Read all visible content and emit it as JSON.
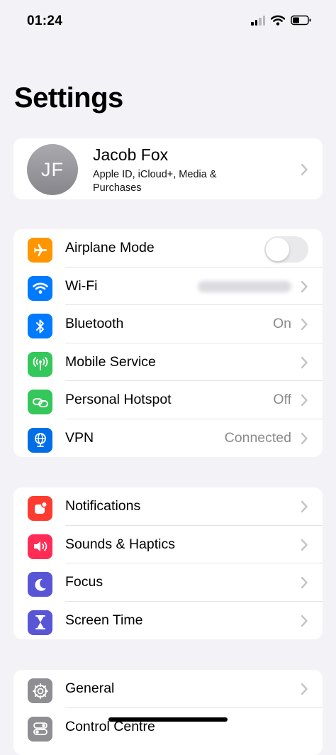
{
  "status_bar": {
    "time": "01:24"
  },
  "header": {
    "title": "Settings"
  },
  "profile": {
    "initials": "JF",
    "name": "Jacob Fox",
    "subtitle": "Apple ID, iCloud+, Media & Purchases"
  },
  "connectivity": {
    "airplane_mode": {
      "label": "Airplane Mode",
      "toggle": "off",
      "icon": "airplane-icon",
      "color": "#ff9500"
    },
    "wifi": {
      "label": "Wi-Fi",
      "icon": "wifi-icon",
      "color": "#007aff"
    },
    "bluetooth": {
      "label": "Bluetooth",
      "value": "On",
      "icon": "bluetooth-icon",
      "color": "#007aff"
    },
    "mobile_service": {
      "label": "Mobile Service",
      "icon": "antenna-icon",
      "color": "#34c759"
    },
    "personal_hotspot": {
      "label": "Personal Hotspot",
      "value": "Off",
      "icon": "hotspot-icon",
      "color": "#34c759"
    },
    "vpn": {
      "label": "VPN",
      "value": "Connected",
      "icon": "globe-icon",
      "color": "#006ee6"
    }
  },
  "alerts": {
    "notifications": {
      "label": "Notifications",
      "icon": "bell-icon",
      "color": "#ff3b30"
    },
    "sounds": {
      "label": "Sounds & Haptics",
      "icon": "speaker-icon",
      "color": "#ff2d55"
    },
    "focus": {
      "label": "Focus",
      "icon": "moon-icon",
      "color": "#5856d6"
    },
    "screen_time": {
      "label": "Screen Time",
      "icon": "hourglass-icon",
      "color": "#5856d6"
    }
  },
  "system": {
    "general": {
      "label": "General",
      "icon": "gear-icon",
      "color": "#8e8e93"
    },
    "control_centre": {
      "label": "Control Centre",
      "icon": "toggles-icon",
      "color": "#8e8e93"
    }
  }
}
